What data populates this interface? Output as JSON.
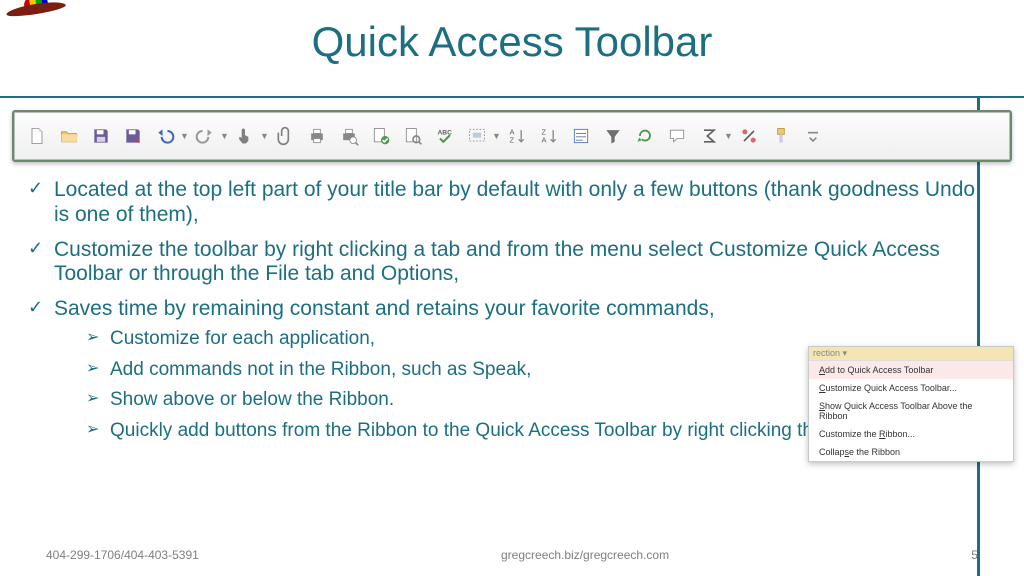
{
  "title": "Quick Access Toolbar",
  "toolbar": {
    "icons": [
      "new-file-icon",
      "open-folder-icon",
      "save-icon",
      "save-as-icon",
      "undo-icon",
      "redo-icon",
      "touch-icon",
      "attach-icon",
      "quick-print-icon",
      "print-preview-icon",
      "spellcheck-ok-icon",
      "doc-search-icon",
      "spelling-icon",
      "selection-icon",
      "sort-asc-icon",
      "sort-desc-icon",
      "form-icon",
      "filter-icon",
      "refresh-icon",
      "comment-icon",
      "autosum-icon",
      "percent-icon",
      "format-painter-icon",
      "customize-icon"
    ],
    "dropdowns": {
      "undo-icon": true,
      "redo-icon": true,
      "touch-icon": true,
      "selection-icon": true,
      "autosum-icon": true
    }
  },
  "bullets": {
    "b1": "Located at the top left part of your title bar by default with only a few buttons (thank goodness Undo is one of them),",
    "b2": "Customize the toolbar by right clicking a tab and from the menu select Customize Quick Access Toolbar or through the File tab and Options,",
    "b3": "Saves time by remaining constant and retains your favorite commands,",
    "sub1": "Customize for each application,",
    "sub2": "Add commands not in the Ribbon, such as Speak,",
    "sub3": "Show above or below the Ribbon.",
    "sub4": "Quickly add buttons from the Ribbon to the Quick Access Toolbar by right clicking the button."
  },
  "context_menu": {
    "header": "rection ▾",
    "items": [
      {
        "pre": "",
        "u": "A",
        "post": "dd to Quick Access Toolbar"
      },
      {
        "pre": "",
        "u": "C",
        "post": "ustomize Quick Access Toolbar..."
      },
      {
        "pre": "",
        "u": "S",
        "post": "how Quick Access Toolbar Above the Ribbon"
      },
      {
        "pre": "Customize the ",
        "u": "R",
        "post": "ibbon..."
      },
      {
        "pre": "Collap",
        "u": "s",
        "post": "e the Ribbon"
      }
    ]
  },
  "footer": {
    "left": "404-299-1706/404-403-5391",
    "center": "gregcreech.biz/gregcreech.com",
    "right": "5"
  }
}
